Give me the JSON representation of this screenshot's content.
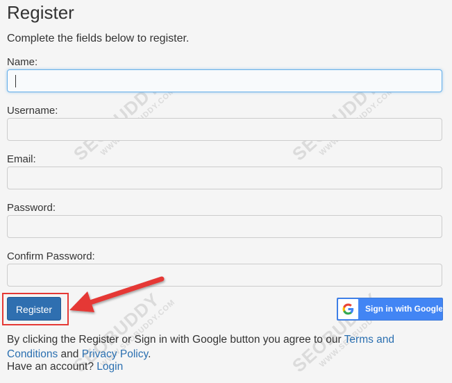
{
  "page": {
    "title": "Register",
    "subtitle": "Complete the fields below to register."
  },
  "form": {
    "name_label": "Name:",
    "username_label": "Username:",
    "email_label": "Email:",
    "password_label": "Password:",
    "confirm_password_label": "Confirm Password:",
    "name_value": "",
    "username_value": "",
    "email_value": "",
    "password_value": "",
    "confirm_password_value": ""
  },
  "actions": {
    "register_label": "Register",
    "google_label": "Sign in with Google"
  },
  "footer": {
    "terms_prefix": "By clicking the Register or Sign in with Google button you agree to our ",
    "terms_link": "Terms and Conditions",
    "terms_and": " and ",
    "privacy_link": "Privacy Policy",
    "terms_suffix": ".",
    "account_prefix": "Have an account? ",
    "login_link": "Login"
  },
  "watermark": {
    "brand": "SEOBUDDY",
    "url": "WWW.SEOBUDDY.COM"
  },
  "colors": {
    "primary": "#2f6fb0",
    "google_blue": "#4285f4",
    "highlight_red": "#e53935",
    "link": "#2a6fb0"
  }
}
